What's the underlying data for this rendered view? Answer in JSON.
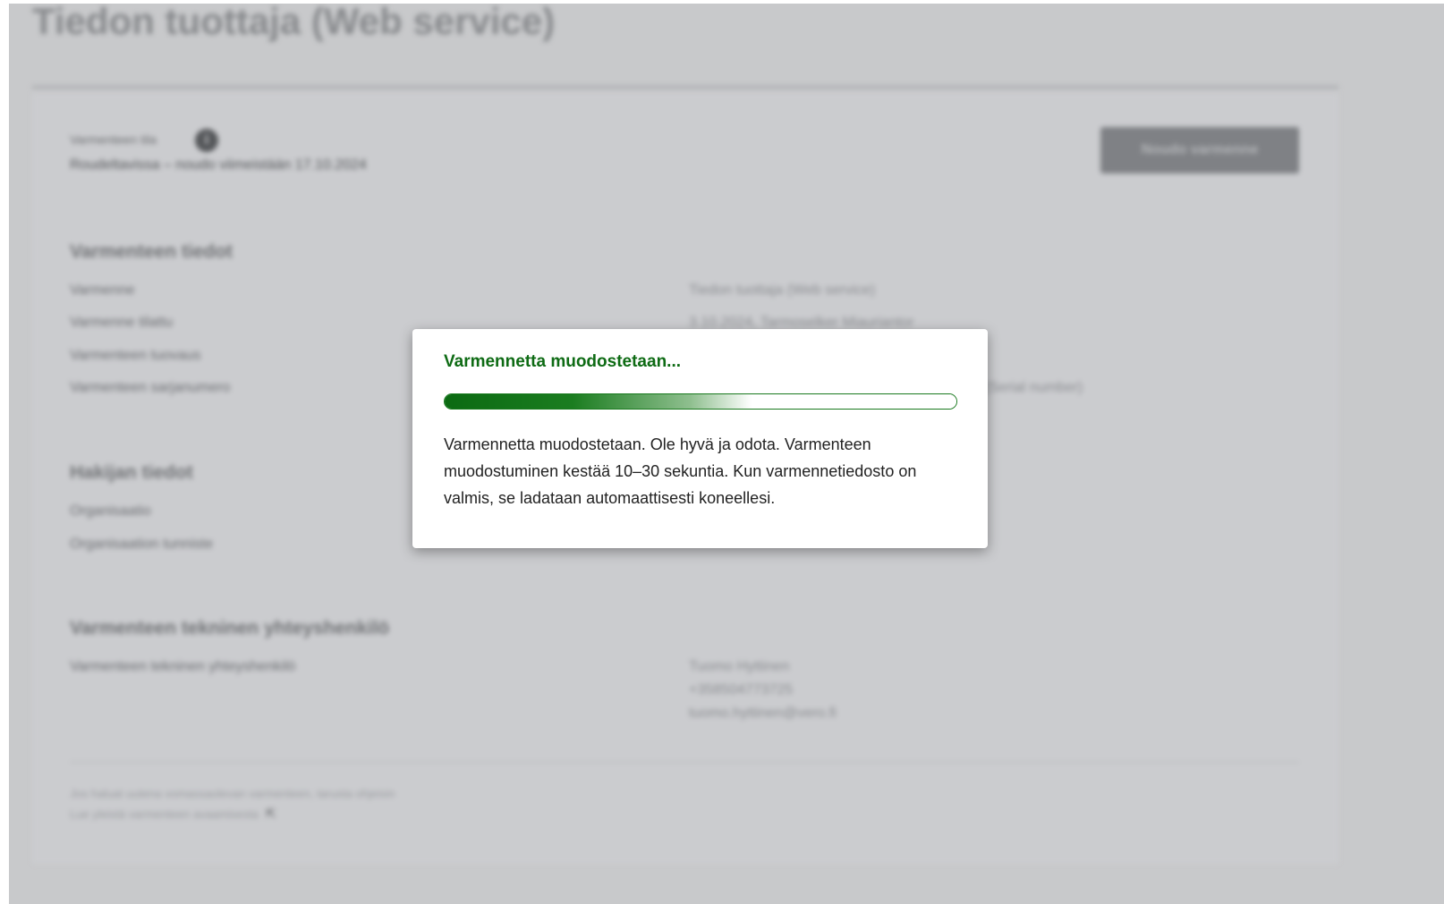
{
  "page": {
    "title": "Tiedon tuottaja (Web service)",
    "cert_type_label": "Varmenteen tila",
    "info_icon": "info-icon",
    "cert_status": "Roudeltavissa – noudo viimeistään 17.10.2024",
    "renew_button": "Noudo varmenne"
  },
  "certificate_info": {
    "heading": "Varmenteen tiedot",
    "rows": [
      {
        "label": "Varmenne",
        "value": "Tiedon tuottaja (Web service)"
      },
      {
        "label": "Varmenne tilattu",
        "value": "3.10.2024, Tarmoselker Miauriantor"
      },
      {
        "label": "Varmenteen tuovaus",
        "value": ""
      },
      {
        "label": "Varmenteen sarjanumero",
        "value": "(Serial number)"
      }
    ]
  },
  "applicant_info": {
    "heading": "Hakijan tiedot",
    "rows": [
      {
        "label": "Organisaatio",
        "value": ""
      },
      {
        "label": "Organisaation tunniste",
        "value": ""
      }
    ]
  },
  "technical_contact": {
    "heading": "Varmenteen tekninen yhteyshenkilö",
    "label": "Varmenteen tekninen yhteyshenkilö",
    "name": "Tuomo Hyttinen",
    "phone": "+358504773725",
    "email": "tuomo.hyttinen@vero.fi"
  },
  "footer": {
    "line1": "Jos haluat uutena vomassaolevan varmenteen, tarusta ohjeisin",
    "line2": "Lue yleistä varmenteen avaamisesta",
    "external_icon": "external-link-icon"
  },
  "modal": {
    "title": "Varmennetta muodostetaan...",
    "progress": 0.5,
    "progress_color": "#0e6b14",
    "message": "Varmennetta muodostetaan. Ole hyvä ja odota. Varmenteen muodostuminen kestää 10–30 sekuntia. Kun varmennetiedosto on valmis, se ladataan automaattisesti koneellesi."
  }
}
